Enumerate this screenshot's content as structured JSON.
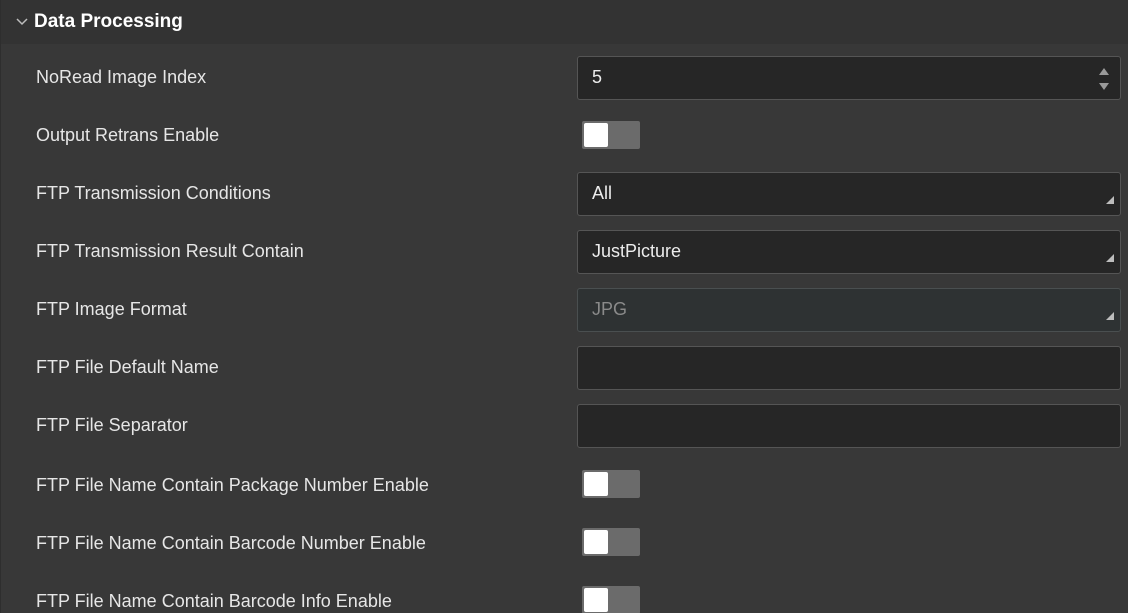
{
  "section": {
    "title": "Data Processing",
    "expanded": true,
    "icon": "chevron-down-icon"
  },
  "rows": [
    {
      "label": "NoRead Image Index",
      "type": "spinbox",
      "value": "5"
    },
    {
      "label": "Output Retrans Enable",
      "type": "toggle",
      "checked": false
    },
    {
      "label": "FTP Transmission Conditions",
      "type": "combo",
      "value": "All"
    },
    {
      "label": "FTP Transmission Result Contain",
      "type": "combo",
      "value": "JustPicture"
    },
    {
      "label": "FTP Image Format",
      "type": "combo",
      "value": "JPG",
      "disabled": true
    },
    {
      "label": "FTP File Default Name",
      "type": "text",
      "value": ""
    },
    {
      "label": "FTP File Separator",
      "type": "text",
      "value": ""
    },
    {
      "label": "FTP File Name Contain Package Number Enable",
      "type": "toggle",
      "checked": false
    },
    {
      "label": "FTP File Name Contain Barcode Number Enable",
      "type": "toggle",
      "checked": false
    },
    {
      "label": "FTP File Name Contain Barcode Info Enable",
      "type": "toggle",
      "checked": false
    }
  ],
  "colors": {
    "panel_bg": "#383838",
    "header_bg": "#333333",
    "field_bg": "#262626",
    "toggle_off": "#6b6b6b"
  }
}
